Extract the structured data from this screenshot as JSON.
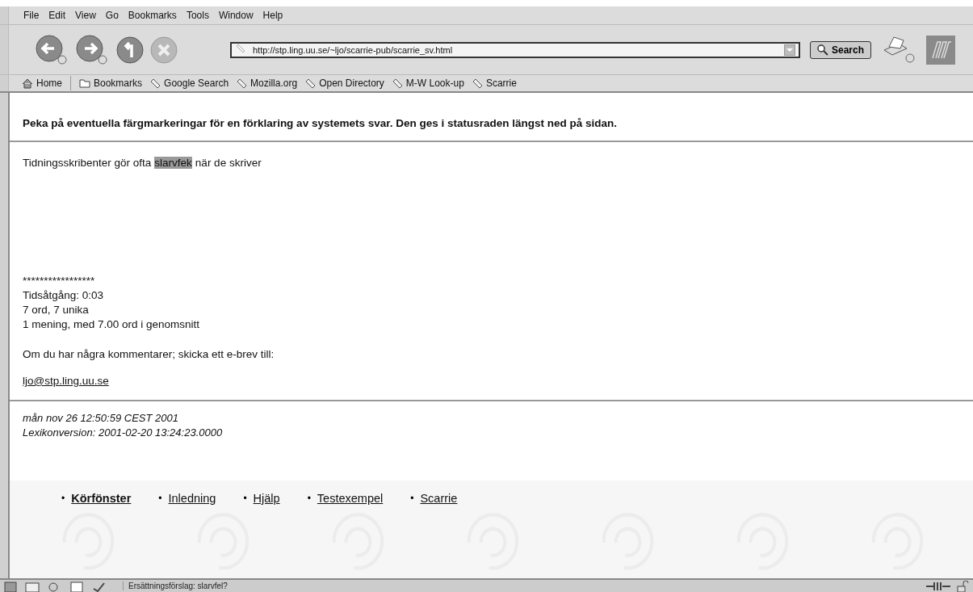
{
  "menu": [
    "File",
    "Edit",
    "View",
    "Go",
    "Bookmarks",
    "Tools",
    "Window",
    "Help"
  ],
  "url": "http://stp.ling.uu.se/~ljo/scarrie-pub/scarrie_sv.html",
  "search_button": "Search",
  "bookmarks": [
    {
      "label": "Home",
      "kind": "home"
    },
    {
      "label": "Bookmarks",
      "kind": "folder"
    },
    {
      "label": "Google Search",
      "kind": "link"
    },
    {
      "label": "Mozilla.org",
      "kind": "link"
    },
    {
      "label": "Open Directory",
      "kind": "link"
    },
    {
      "label": "M-W Look-up",
      "kind": "link"
    },
    {
      "label": "Scarrie",
      "kind": "link"
    }
  ],
  "instruction": "Peka på eventuella färgmarkeringar för en förklaring av systemets svar. Den ges i statusraden längst ned på sidan.",
  "sentence": [
    {
      "text": "Tidningsskribenter gör ofta",
      "flagged": false
    },
    {
      "text": "slarvfek",
      "flagged": true
    },
    {
      "text": "när de skriver",
      "flagged": false
    }
  ],
  "stats": [
    "*****************",
    "Tidsåtgång: 0:03",
    "7 ord, 7 unika",
    "1 mening, med 7.00 ord i genomsnitt"
  ],
  "comment": "Om du har några kommentarer; skicka ett e-brev till:",
  "email": "ljo@stp.ling.uu.se",
  "footer": [
    "mån nov 26 12:50:59 CEST 2001",
    "Lexikonversion: 2001-02-20 13:24:23.0000"
  ],
  "nav": [
    {
      "marker": "•",
      "label": "Körfönster",
      "selected": true
    },
    {
      "marker": "•",
      "label": "Inledning",
      "selected": false
    },
    {
      "marker": "•",
      "label": "Hjälp",
      "selected": false
    },
    {
      "marker": "•",
      "label": "Testexempel",
      "selected": false
    },
    {
      "marker": "•",
      "label": "Scarrie",
      "selected": false
    }
  ],
  "status_text": "Ersättningsförslag: slarvfel?"
}
